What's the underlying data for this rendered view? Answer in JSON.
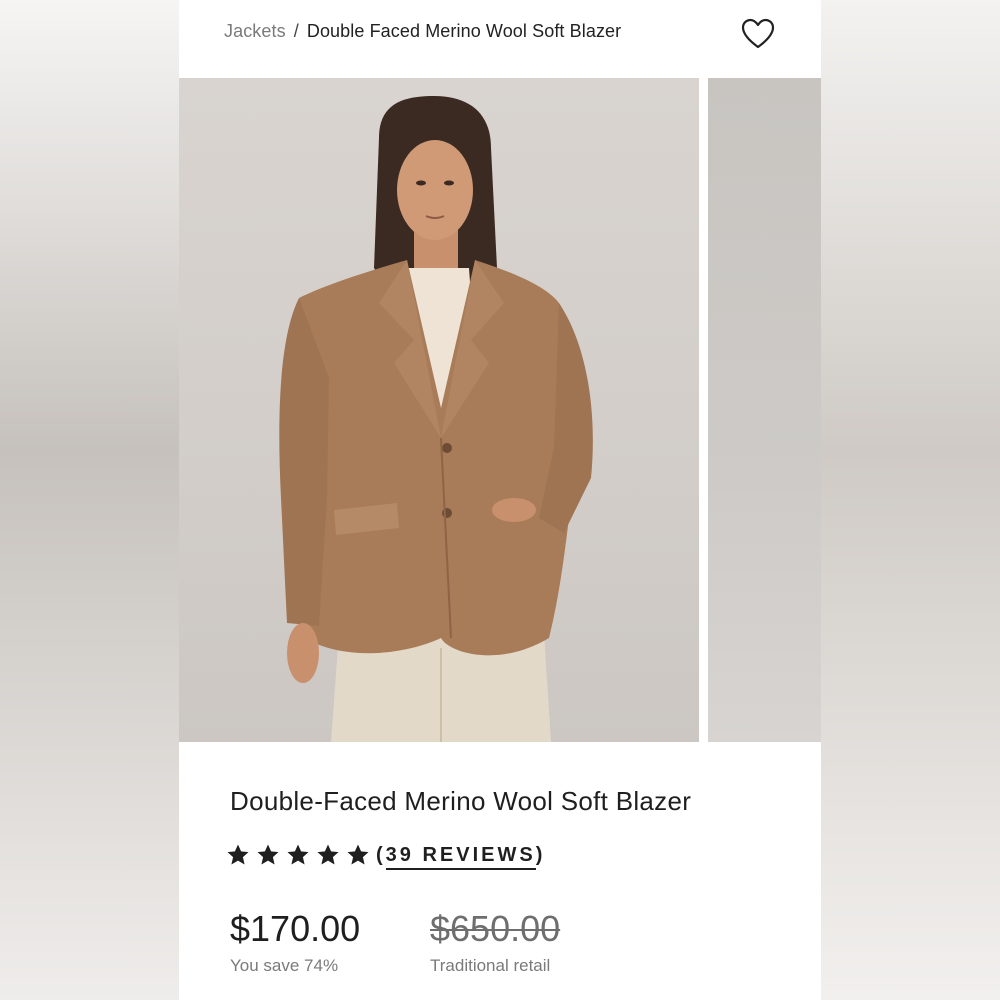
{
  "breadcrumb": {
    "parent": "Jackets",
    "separator": "/",
    "current": "Double Faced Merino Wool Soft Blazer"
  },
  "icons": {
    "wishlist": "heart-icon",
    "star": "star-icon"
  },
  "product": {
    "title": "Double-Faced Merino Wool Soft Blazer",
    "rating_stars": 5,
    "reviews_label": "39 REVIEWS",
    "price": "$170.00",
    "savings": "You save 74%",
    "retail_price": "$650.00",
    "retail_label": "Traditional retail"
  },
  "colors": {
    "text": "#1f1f1f",
    "muted": "#7a7a7a",
    "jacket": "#a87c58",
    "background": "#ffffff"
  }
}
